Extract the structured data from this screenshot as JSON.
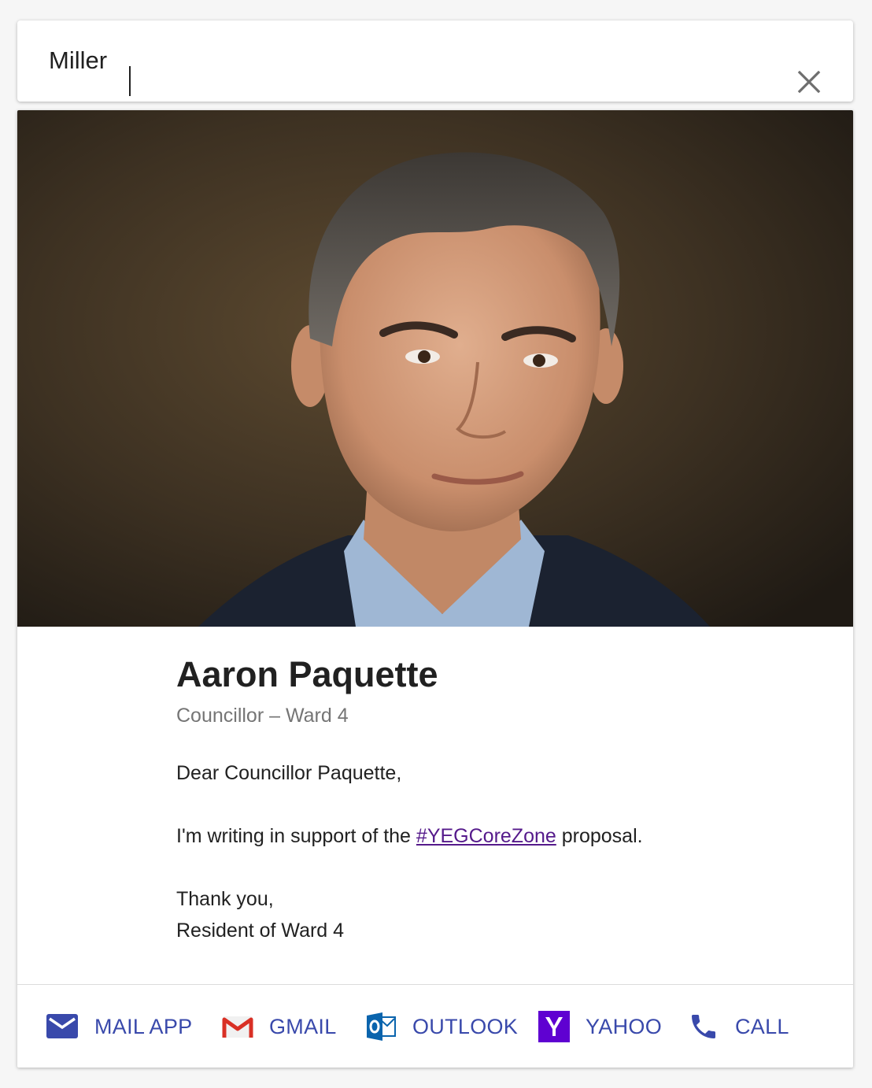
{
  "search": {
    "value": "Miller",
    "close_icon": "close-icon"
  },
  "contact": {
    "photo_alt": "",
    "name": "Aaron Paquette",
    "title": "Councillor – Ward 4"
  },
  "letter": {
    "greeting": "Dear Councillor Paquette,",
    "body_prefix": "I'm writing in support of the ",
    "hashtag": "#YEGCoreZone",
    "body_suffix": " proposal.",
    "closing": "Thank you,",
    "signature": "Resident of Ward 4"
  },
  "actions": [
    {
      "label": "MAIL APP",
      "icon": "envelope-icon"
    },
    {
      "label": "GMAIL",
      "icon": "gmail-icon"
    },
    {
      "label": "OUTLOOK",
      "icon": "outlook-icon"
    },
    {
      "label": "YAHOO",
      "icon": "yahoo-icon"
    },
    {
      "label": "CALL",
      "icon": "phone-icon"
    }
  ],
  "colors": {
    "accent": "#3949ab",
    "link_visited": "#551a8b",
    "gmail_red": "#d93025",
    "outlook_blue": "#0a64ad",
    "yahoo_purple": "#5f01d1"
  }
}
